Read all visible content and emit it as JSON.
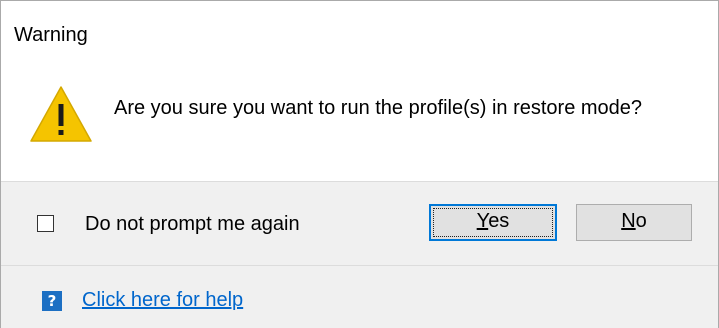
{
  "dialog": {
    "title": "Warning",
    "icon": "warning-icon",
    "message": "Are you sure you want to run the profile(s) in restore mode?"
  },
  "footer": {
    "checkbox": {
      "label": "Do not prompt me again",
      "checked": false
    },
    "buttons": {
      "yes": {
        "mnemonic": "Y",
        "rest": "es"
      },
      "no": {
        "mnemonic": "N",
        "rest": "o"
      }
    },
    "help": {
      "icon": "help-icon",
      "icon_glyph": "?",
      "link_text": "Click here for help"
    }
  },
  "colors": {
    "accent": "#0078d7",
    "link": "#0066cc",
    "warning_fill": "#f5c400",
    "help_icon_bg": "#1c6fc3",
    "footer_bg": "#f0f0f0"
  }
}
